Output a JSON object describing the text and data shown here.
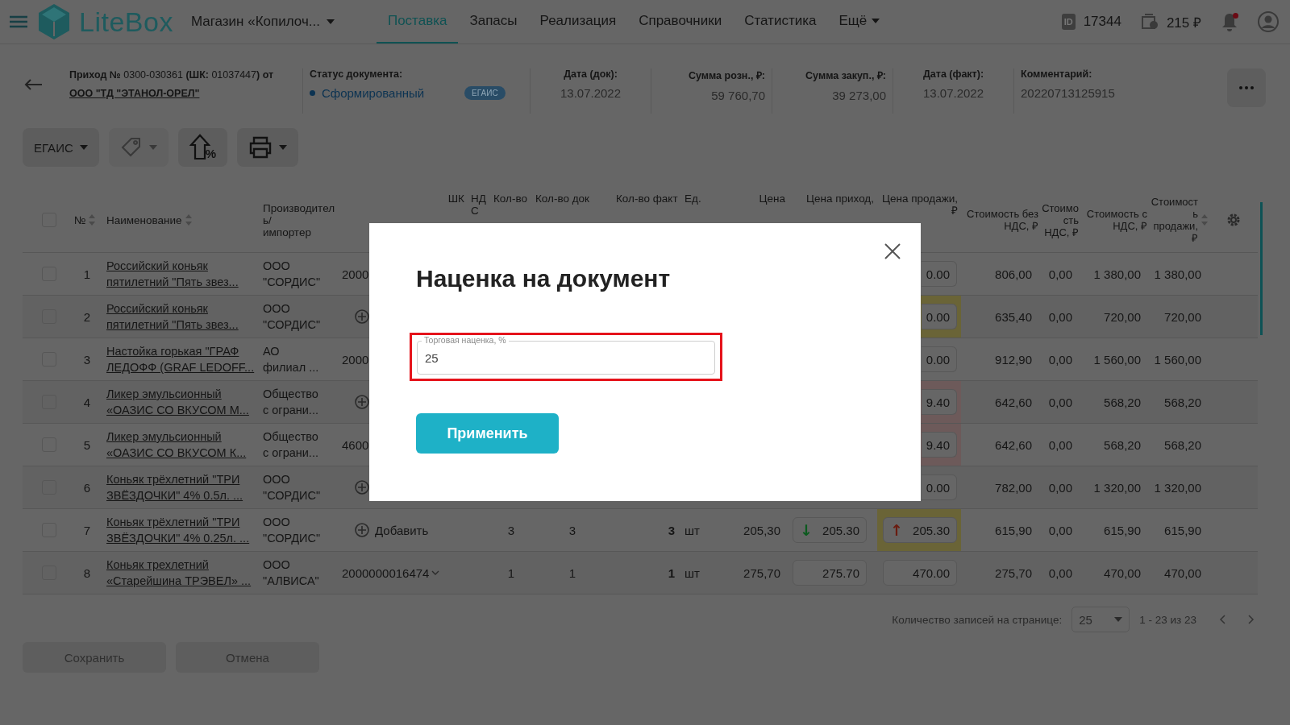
{
  "nav": {
    "logo": "LiteBox",
    "store": "Магазин «Копилоч...",
    "tabs": [
      {
        "label": "Поставка",
        "selected": true,
        "dropdown": false
      },
      {
        "label": "Запасы",
        "selected": false,
        "dropdown": false
      },
      {
        "label": "Реализация",
        "selected": false,
        "dropdown": false
      },
      {
        "label": "Справочники",
        "selected": false,
        "dropdown": false
      },
      {
        "label": "Статистика",
        "selected": false,
        "dropdown": false
      },
      {
        "label": "Ещё",
        "selected": false,
        "dropdown": true
      }
    ],
    "id_badge": "ID",
    "id_value": "17344",
    "balance": "215 ₽",
    "has_notifications": true
  },
  "document": {
    "title": "**Приход №** 0300-030361 **(ШК:** 01037447**) от**",
    "supplier": "ООО \"ТД \"ЭТАНОЛ-ОРЕЛ\"",
    "status_label": "Статус документа:",
    "status": "Сформированный",
    "badge": "ЕГАИС",
    "fields": [
      {
        "label": "Дата (док):",
        "value": "13.07.2022",
        "kind": "date"
      },
      {
        "label": "Сумма розн., ₽:",
        "value": "59 760,70",
        "kind": "sum"
      },
      {
        "label": "Сумма закуп., ₽:",
        "value": "39 273,00",
        "kind": "sum"
      },
      {
        "label": "Дата (факт):",
        "value": "13.07.2022",
        "kind": "date"
      },
      {
        "label": "Комментарий:",
        "value": "20220713125915",
        "kind": "text"
      }
    ]
  },
  "toolbar": [
    {
      "kind": "egais",
      "label": "ЕГАИС",
      "disabled": false
    },
    {
      "kind": "tag",
      "disabled": true
    },
    {
      "kind": "markup",
      "icon_text": "%",
      "disabled": false
    },
    {
      "kind": "print",
      "disabled": false
    }
  ],
  "table": {
    "header_checked": false,
    "columns": [
      {
        "label": "№",
        "sortable": true
      },
      {
        "label": "Наименование",
        "sortable": true
      },
      {
        "label": "Производитель/\nимпортер",
        "sortable": false
      },
      {
        "label": "ШК",
        "sortable": false
      },
      {
        "label": "НДС",
        "sortable": false
      },
      {
        "label": "Кол-во",
        "sortable": false
      },
      {
        "label": "Кол-во док",
        "sortable": false
      },
      {
        "label": "Кол-во факт",
        "sortable": false
      },
      {
        "label": "Ед.",
        "sortable": false
      },
      {
        "label": "Цена",
        "sortable": false
      },
      {
        "label": "Цена приход,",
        "sortable": false
      },
      {
        "label": "Цена продажи, ₽",
        "sortable": false
      },
      {
        "label": "Стоимость без НДС, ₽",
        "sortable": false
      },
      {
        "label": "Стоимость НДС, ₽",
        "sortable": false
      },
      {
        "label": "Стоимость с НДС, ₽",
        "sortable": false
      },
      {
        "label": "Стоимость продажи, ₽",
        "sortable": true
      }
    ],
    "rows": [
      {
        "checked": false,
        "num": "1",
        "name": "Российский коньяк\nпятилетний \"Пять звез...",
        "maker": "ООО\n\"СОРДИС\"",
        "barcode": {
          "kind": "value",
          "text": "2000"
        },
        "price_out": {
          "value": "0.00"
        },
        "cost_net": "806,00",
        "vat": "0,00",
        "cost_gross": "1 380,00",
        "sale_total": "1 380,00"
      },
      {
        "checked": false,
        "num": "2",
        "name": "Российский коньяк\nпятилетний \"Пять звез...",
        "maker": "ООО\n\"СОРДИС\"",
        "barcode": {
          "kind": "add"
        },
        "price_out": {
          "value": "0.00",
          "color": "#6a6437"
        },
        "cost_net": "635,40",
        "vat": "0,00",
        "cost_gross": "720,00",
        "sale_total": "720,00"
      },
      {
        "checked": false,
        "num": "3",
        "name": "Настойка горькая \"ГРАФ\nЛЕДОФФ (GRAF LEDOFF...",
        "maker": "АО\nфилиал ...",
        "barcode": {
          "kind": "value",
          "text": "2000"
        },
        "price_out": {
          "value": "0.00"
        },
        "cost_net": "912,90",
        "vat": "0,00",
        "cost_gross": "1 560,00",
        "sale_total": "1 560,00"
      },
      {
        "checked": false,
        "num": "4",
        "name": "Ликер эмульсионный\n«ОАЗИС СО ВКУСОМ М...",
        "maker": "Общество\nс ограни...",
        "barcode": {
          "kind": "add"
        },
        "price_out": {
          "value": "9.40",
          "color": "#6d5a5a"
        },
        "cost_net": "642,60",
        "vat": "0,00",
        "cost_gross": "568,20",
        "sale_total": "568,20"
      },
      {
        "checked": false,
        "num": "5",
        "name": "Ликер эмульсионный\n«ОАЗИС СО ВКУСОМ К...",
        "maker": "Общество\nс ограни...",
        "barcode": {
          "kind": "value",
          "text": "4600"
        },
        "price_out": {
          "value": "9.40",
          "color": "#6d5a5a"
        },
        "cost_net": "642,60",
        "vat": "0,00",
        "cost_gross": "568,20",
        "sale_total": "568,20"
      },
      {
        "checked": false,
        "num": "6",
        "name": "Коньяк трёхлетний \"ТРИ\nЗВЁЗДОЧКИ\" 4% 0.5л. ...",
        "maker": "ООО\n\"СОРДИС\"",
        "barcode": {
          "kind": "add"
        },
        "price_out": {
          "value": "0.00"
        },
        "cost_net": "782,00",
        "vat": "0,00",
        "cost_gross": "1 320,00",
        "sale_total": "1 320,00"
      },
      {
        "checked": false,
        "num": "7",
        "name": "Коньяк трёхлетний \"ТРИ\nЗВЁЗДОЧКИ\" 4% 0.25л. ...",
        "maker": "ООО\n\"СОРДИС\"",
        "barcode": {
          "kind": "add",
          "label": "Добавить"
        },
        "qty": "3",
        "qty_doc": "3",
        "qty_fact": "3",
        "unit": "шт",
        "price": "205,30",
        "price_in": {
          "value": "205.30",
          "arrow": {
            "glyph": "↓",
            "color": "#0b5a1e"
          }
        },
        "price_out": {
          "value": "205.30",
          "arrow": {
            "glyph": "↑",
            "color": "#6a1c10"
          },
          "color": "#6a6437"
        },
        "cost_net": "615,90",
        "vat": "0,00",
        "cost_gross": "615,90",
        "sale_total": "615,90"
      },
      {
        "checked": false,
        "num": "8",
        "name": "Коньяк трехлетний\n«Старейшина ТРЭВЕЛ» ...",
        "maker": "ООО\n\"АЛВИСА\"",
        "barcode": {
          "kind": "value",
          "text": "2000000016474",
          "dropdown": true
        },
        "qty": "1",
        "qty_doc": "1",
        "qty_fact": "1",
        "unit": "шт",
        "price": "275,70",
        "price_in": {
          "value": "275.70"
        },
        "price_out": {
          "value": "470.00"
        },
        "cost_net": "275,70",
        "vat": "0,00",
        "cost_gross": "470,00",
        "sale_total": "470,00"
      }
    ]
  },
  "pagination": {
    "label": "Количество записей на странице:",
    "page_size": "25",
    "range": "1 - 23 из 23"
  },
  "footer_buttons": [
    {
      "label": "Сохранить",
      "disabled": true
    },
    {
      "label": "Отмена",
      "disabled": true
    }
  ],
  "modal": {
    "title": "Наценка на документ",
    "field_label": "Торговая наценка, %",
    "field_value": "25",
    "outlined": true,
    "button": "Применить"
  }
}
